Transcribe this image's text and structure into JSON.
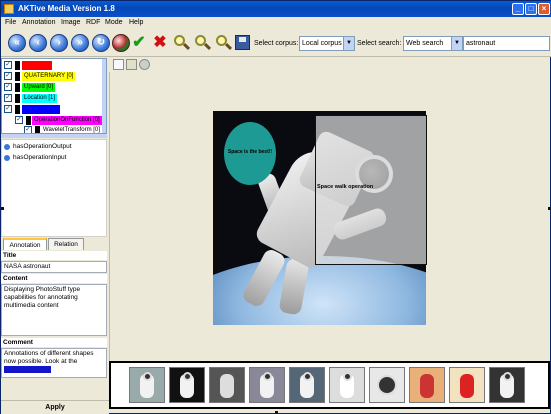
{
  "window": {
    "title": "AKTive Media Version 1.8",
    "buttons": [
      "_",
      "□",
      "×"
    ]
  },
  "menu": [
    "File",
    "Annotation",
    "Image",
    "RDF",
    "Mode",
    "Help"
  ],
  "toolbar": {
    "nav_icons": [
      "back-icon",
      "back-icon",
      "forward-icon",
      "forward-icon",
      "refresh-icon",
      "globe-icon",
      "check-icon",
      "delete-icon",
      "zoom-in-icon",
      "zoom-icon",
      "zoom-out-icon",
      "save-icon"
    ],
    "select_corpus_label": "Select corpus:",
    "corpus_value": "Local corpus",
    "select_search_label": "Select search:",
    "search_value": "Web search",
    "search_query": "astronaut"
  },
  "tree": {
    "items": [
      {
        "label": "",
        "color": "#ff0000",
        "checked": true
      },
      {
        "label": "QUATERNARY [0]",
        "color": "#ffff00",
        "checked": true
      },
      {
        "label": "Upward [0]",
        "color": "#00ff00",
        "checked": true
      },
      {
        "label": "Location [1]",
        "color": "#00ffff",
        "checked": true
      },
      {
        "label": "",
        "color": "#0000ff",
        "checked": true
      },
      {
        "label": "OperationOnFunction [0]",
        "color": "#ff00ff",
        "checked": true
      },
      {
        "label": "WaveletTransform [0]",
        "color": "#ffffff",
        "checked": true
      }
    ]
  },
  "properties": [
    "hasOperationOutput",
    "hasOperationInput"
  ],
  "tabs": [
    "Annotation",
    "Relation"
  ],
  "annotation": {
    "title_label": "Title",
    "title_value": "NASA astronaut",
    "content_label": "Content",
    "content_value": "Displaying PhotoStuff type capabilities for annotating multimedia content",
    "comment_label": "Comment",
    "comment_value": "Annotations of different shapes now possible. Look at the",
    "apply_label": "Apply"
  },
  "canvas": {
    "ellipse_label": "Space is the best!!",
    "rect_label": "Space walk operation"
  },
  "thumbnails": [
    "astronaut-thumb-1",
    "astronaut-thumb-2",
    "astronaut-thumb-3",
    "astronaut-thumb-4",
    "astronaut-thumb-5",
    "astronaut-thumb-6",
    "astronaut-thumb-7",
    "astronaut-thumb-8",
    "astronaut-thumb-9",
    "astronaut-thumb-10"
  ],
  "colors": {
    "title_bar": "#0a5cd8",
    "ellipse": "#1d9a93",
    "highlight": "#1414c8"
  }
}
